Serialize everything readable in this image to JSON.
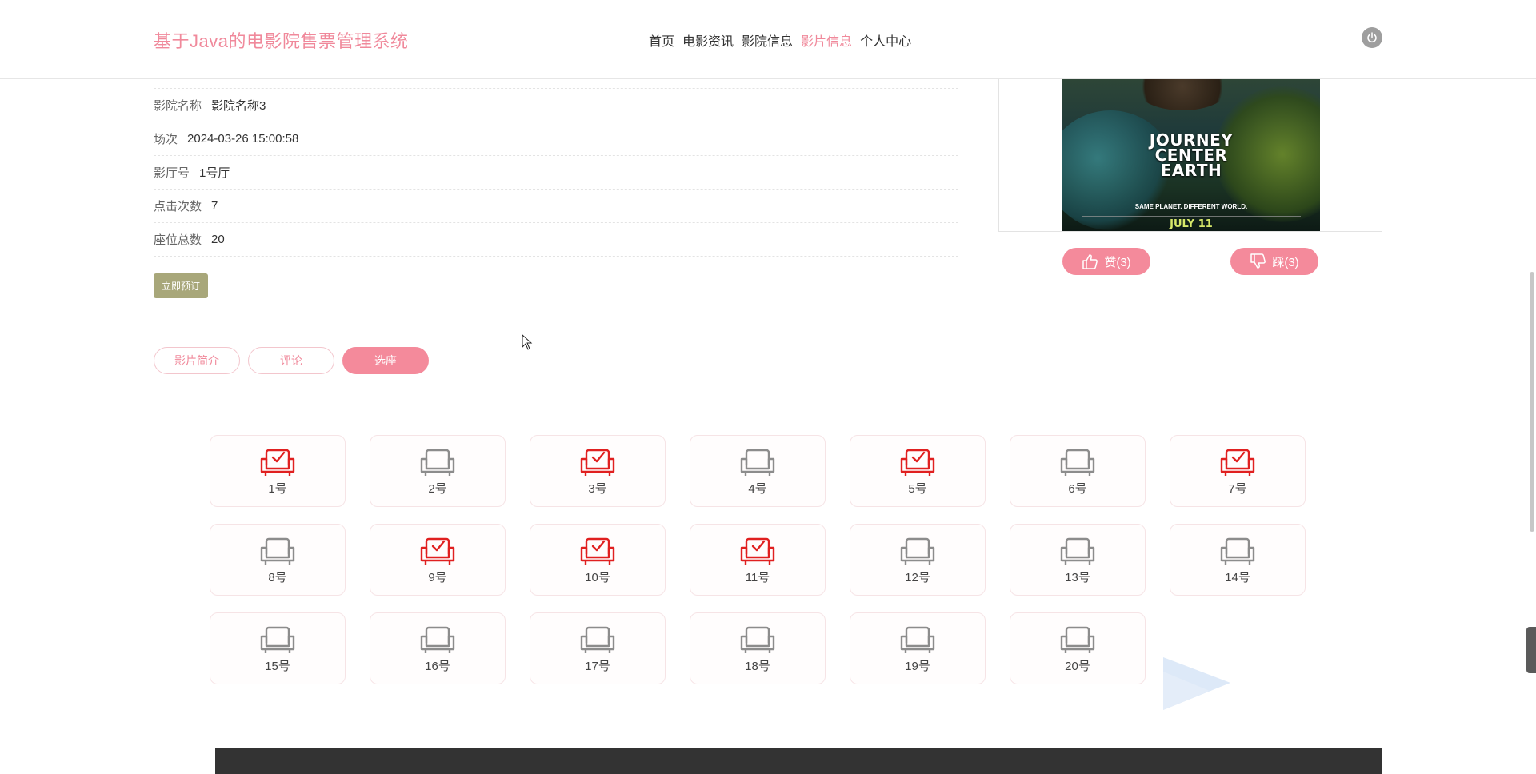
{
  "header": {
    "site_title": "基于Java的电影院售票管理系统",
    "nav": [
      {
        "label": "首页",
        "active": false
      },
      {
        "label": "电影资讯",
        "active": false
      },
      {
        "label": "影院信息",
        "active": false
      },
      {
        "label": "影片信息",
        "active": true
      },
      {
        "label": "个人中心",
        "active": false
      }
    ]
  },
  "info": {
    "rows": [
      {
        "label": "影院名称",
        "value": "影院名称3"
      },
      {
        "label": "场次",
        "value": "2024-03-26 15:00:58"
      },
      {
        "label": "影厅号",
        "value": "1号厅"
      },
      {
        "label": "点击次数",
        "value": "7"
      },
      {
        "label": "座位总数",
        "value": "20"
      }
    ],
    "book_button": "立即预订"
  },
  "poster": {
    "title_line1": "JOURNEY",
    "title_line2": "CENTER",
    "title_line3": "EARTH",
    "tagline": "SAME PLANET. DIFFERENT WORLD.",
    "date": "JULY 11"
  },
  "votes": {
    "like_label": "赞(3)",
    "dislike_label": "踩(3)"
  },
  "tabs": [
    {
      "label": "影片简介",
      "active": false
    },
    {
      "label": "评论",
      "active": false
    },
    {
      "label": "选座",
      "active": true
    }
  ],
  "seats": [
    {
      "label": "1号",
      "booked": true
    },
    {
      "label": "2号",
      "booked": false
    },
    {
      "label": "3号",
      "booked": true
    },
    {
      "label": "4号",
      "booked": false
    },
    {
      "label": "5号",
      "booked": true
    },
    {
      "label": "6号",
      "booked": false
    },
    {
      "label": "7号",
      "booked": true
    },
    {
      "label": "8号",
      "booked": false
    },
    {
      "label": "9号",
      "booked": true
    },
    {
      "label": "10号",
      "booked": true
    },
    {
      "label": "11号",
      "booked": true
    },
    {
      "label": "12号",
      "booked": false
    },
    {
      "label": "13号",
      "booked": false
    },
    {
      "label": "14号",
      "booked": false
    },
    {
      "label": "15号",
      "booked": false
    },
    {
      "label": "16号",
      "booked": false
    },
    {
      "label": "17号",
      "booked": false
    },
    {
      "label": "18号",
      "booked": false
    },
    {
      "label": "19号",
      "booked": false
    },
    {
      "label": "20号",
      "booked": false
    }
  ],
  "colors": {
    "accent": "#f48a9b",
    "booked_seat": "#e02020",
    "free_seat": "#8c8c8c",
    "book_button": "#a8a77a"
  }
}
